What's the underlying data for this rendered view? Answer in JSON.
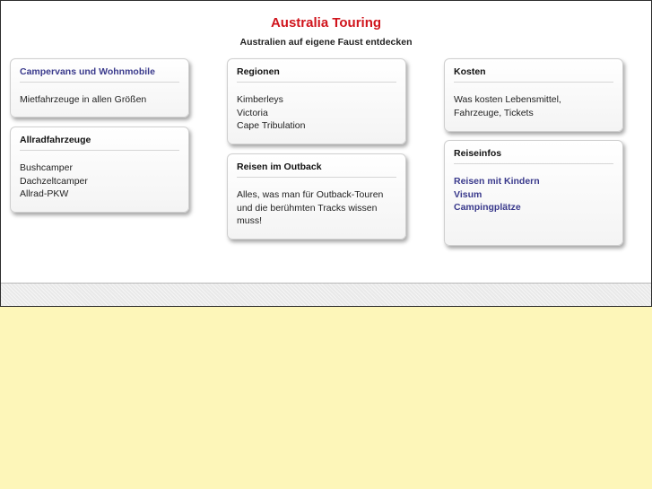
{
  "header": {
    "title": "Australia Touring",
    "subtitle": "Australien auf eigene Faust entdecken"
  },
  "boxes": {
    "campervans": {
      "title": "Campervans und Wohnmobile",
      "lines": [
        "Mietfahrzeuge in allen Größen"
      ]
    },
    "allrad": {
      "title": "Allradfahrzeuge",
      "lines": [
        "Bushcamper",
        "Dachzeltcamper",
        "Allrad-PKW"
      ]
    },
    "regionen": {
      "title": "Regionen",
      "lines": [
        "Kimberleys",
        "Victoria",
        "Cape Tribulation"
      ]
    },
    "outback": {
      "title": "Reisen im Outback",
      "lines": [
        "Alles, was man für Outback-Touren",
        "und die berühmten Tracks wissen",
        "muss!"
      ]
    },
    "kosten": {
      "title": "Kosten",
      "lines": [
        "Was kosten Lebensmittel,",
        "Fahrzeuge, Tickets"
      ]
    },
    "reiseinfos": {
      "title": "Reiseinfos",
      "links": [
        "Reisen mit Kindern",
        "Visum",
        "Campingplätze"
      ]
    }
  },
  "colors": {
    "title_red": "#d0141c",
    "link_blue": "#3a3a8c",
    "page_background": "#fdf6b9"
  }
}
